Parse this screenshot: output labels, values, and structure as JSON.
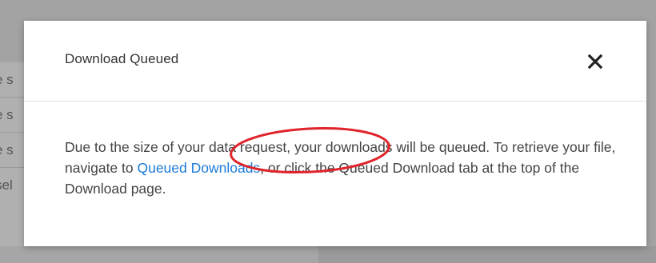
{
  "background": {
    "rows": [
      "e s",
      "e s",
      "e s",
      "sel"
    ]
  },
  "modal": {
    "title": "Download Queued",
    "close_icon": "close-icon",
    "body": {
      "text_before_link": "Due to the size of your data request, your downloads will be queued. To retrieve your file, navigate to ",
      "link_text": "Queued Downloads",
      "text_after_link": ", or click the Queued Download tab at the top of the Download page."
    }
  },
  "annotation": {
    "highlight_color": "#e0242b"
  },
  "colors": {
    "link": "#1e7bd9",
    "overlay": "#9e9e9e",
    "modal_bg": "#ffffff"
  }
}
